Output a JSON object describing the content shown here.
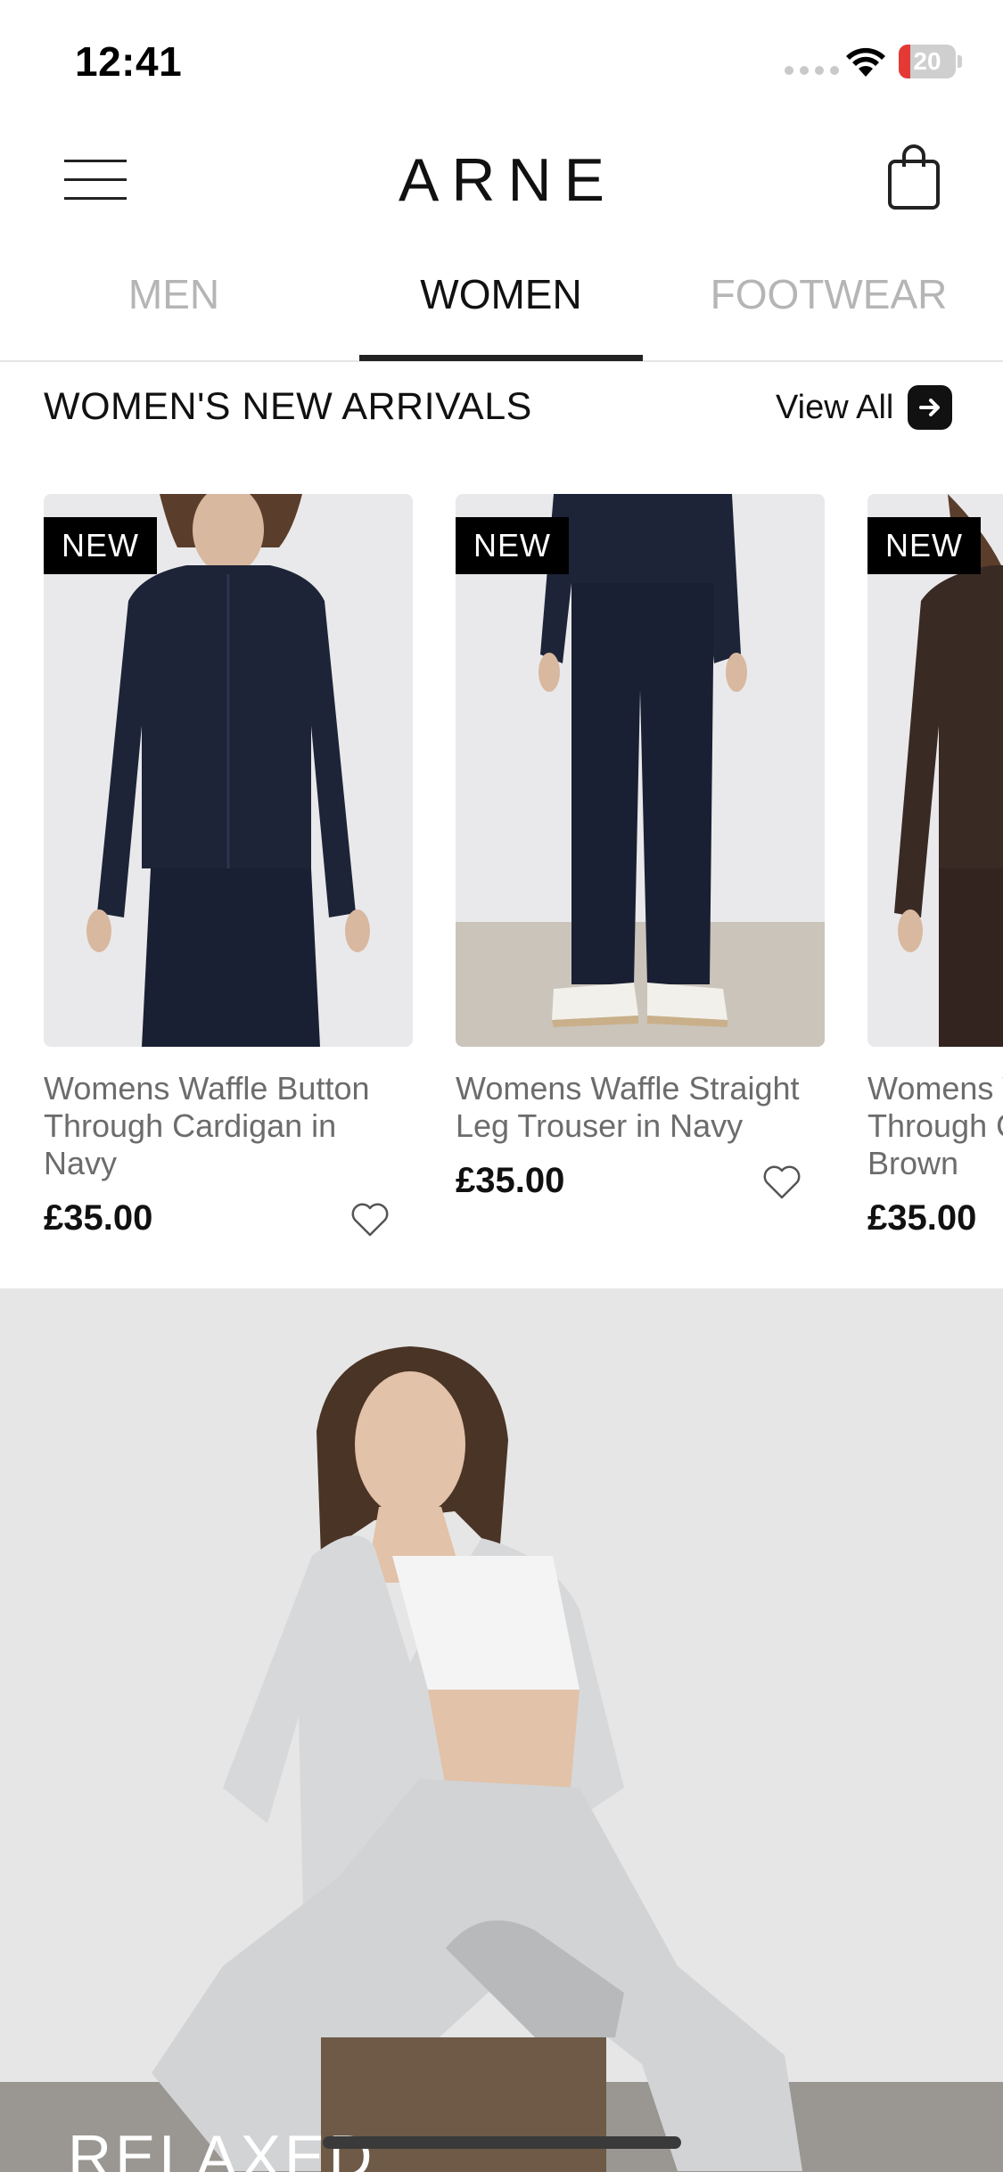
{
  "status_bar": {
    "time": "12:41",
    "battery_level": "20",
    "battery_fraction": 0.2
  },
  "header": {
    "logo": "ARNE",
    "menu_icon": "hamburger-menu-icon",
    "bag_icon": "shopping-bag-icon"
  },
  "tabs": [
    {
      "label": "MEN",
      "active": false
    },
    {
      "label": "WOMEN",
      "active": true
    },
    {
      "label": "FOOTWEAR",
      "active": false
    }
  ],
  "section": {
    "title": "WOMEN'S NEW ARRIVALS",
    "view_all": "View All",
    "view_all_icon": "arrow-right-icon"
  },
  "products": [
    {
      "badge": "NEW",
      "name": "Womens Waffle Button Through Cardigan in Navy",
      "price": "£35.00"
    },
    {
      "badge": "NEW",
      "name": "Womens Waffle Straight Leg Trouser in Navy",
      "price": "£35.00"
    },
    {
      "badge": "NEW",
      "name": "Womens Waffle Button Through Cardigan in Brown",
      "price": "£35.00"
    }
  ],
  "banner": {
    "text": "RELAXED"
  },
  "colors": {
    "accent": "#111111",
    "muted_tab": "#b5b5b5",
    "product_name": "#6c6c6c",
    "battery_low": "#e53935"
  }
}
